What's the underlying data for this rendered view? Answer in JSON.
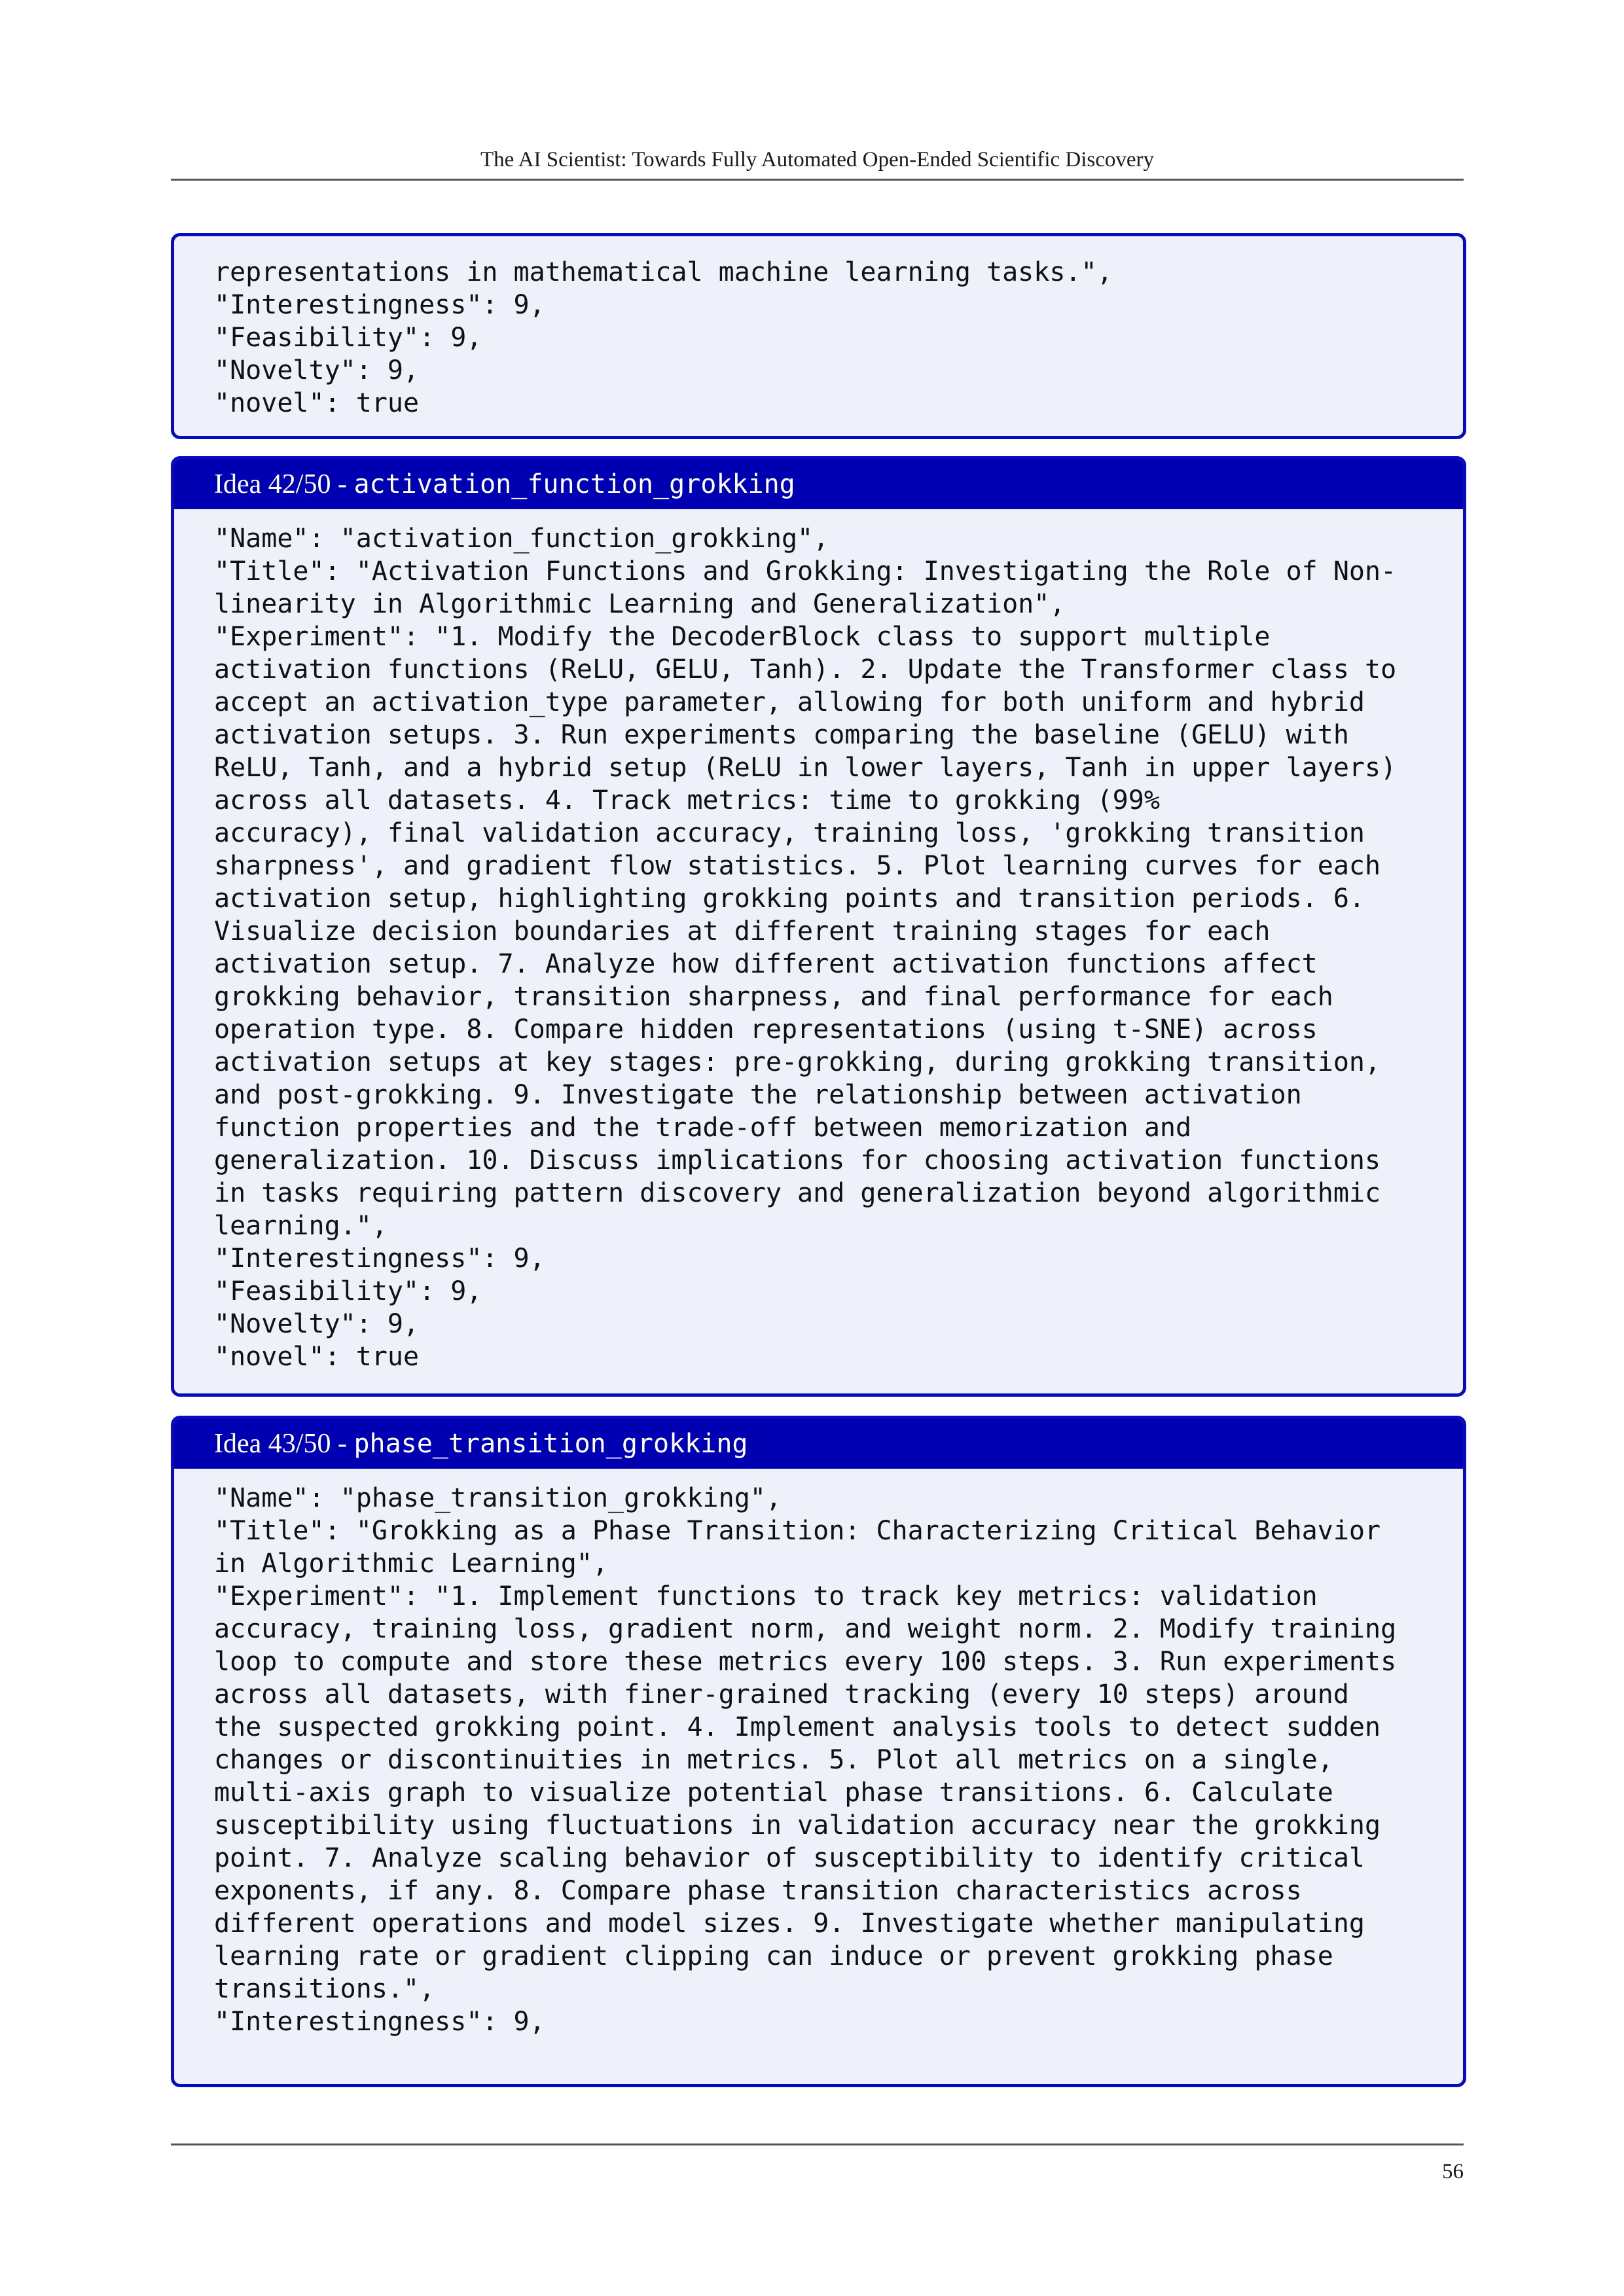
{
  "header": {
    "running_title": "The AI Scientist: Towards Fully Automated Open-Ended Scientific Discovery"
  },
  "box_top": {
    "lines": [
      "representations in mathematical machine learning tasks.\",",
      "\"Interestingness\": 9,",
      "\"Feasibility\": 9,",
      "\"Novelty\": 9,",
      "\"novel\": true"
    ]
  },
  "idea42": {
    "label": "Idea 42/50 - ",
    "name": "activation_function_grokking",
    "lines": [
      "\"Name\": \"activation_function_grokking\",",
      "\"Title\": \"Activation Functions and Grokking: Investigating the Role of Non-",
      "linearity in Algorithmic Learning and Generalization\",",
      "\"Experiment\": \"1. Modify the DecoderBlock class to support multiple",
      "activation functions (ReLU, GELU, Tanh). 2. Update the Transformer class to",
      "accept an activation_type parameter, allowing for both uniform and hybrid",
      "activation setups. 3. Run experiments comparing the baseline (GELU) with",
      "ReLU, Tanh, and a hybrid setup (ReLU in lower layers, Tanh in upper layers)",
      "across all datasets. 4. Track metrics: time to grokking (99%",
      "accuracy), final validation accuracy, training loss, 'grokking transition",
      "sharpness', and gradient flow statistics. 5. Plot learning curves for each",
      "activation setup, highlighting grokking points and transition periods. 6.",
      "Visualize decision boundaries at different training stages for each",
      "activation setup. 7. Analyze how different activation functions affect",
      "grokking behavior, transition sharpness, and final performance for each",
      "operation type. 8. Compare hidden representations (using t-SNE) across",
      "activation setups at key stages: pre-grokking, during grokking transition,",
      "and post-grokking. 9. Investigate the relationship between activation",
      "function properties and the trade-off between memorization and",
      "generalization. 10. Discuss implications for choosing activation functions",
      "in tasks requiring pattern discovery and generalization beyond algorithmic",
      "learning.\",",
      "\"Interestingness\": 9,",
      "\"Feasibility\": 9,",
      "\"Novelty\": 9,",
      "\"novel\": true"
    ]
  },
  "idea43": {
    "label": "Idea 43/50 - ",
    "name": "phase_transition_grokking",
    "lines": [
      "\"Name\": \"phase_transition_grokking\",",
      "\"Title\": \"Grokking as a Phase Transition: Characterizing Critical Behavior",
      "in Algorithmic Learning\",",
      "\"Experiment\": \"1. Implement functions to track key metrics: validation",
      "accuracy, training loss, gradient norm, and weight norm. 2. Modify training",
      "loop to compute and store these metrics every 100 steps. 3. Run experiments",
      "across all datasets, with finer-grained tracking (every 10 steps) around",
      "the suspected grokking point. 4. Implement analysis tools to detect sudden",
      "changes or discontinuities in metrics. 5. Plot all metrics on a single,",
      "multi-axis graph to visualize potential phase transitions. 6. Calculate",
      "susceptibility using fluctuations in validation accuracy near the grokking",
      "point. 7. Analyze scaling behavior of susceptibility to identify critical",
      "exponents, if any. 8. Compare phase transition characteristics across",
      "different operations and model sizes. 9. Investigate whether manipulating",
      "learning rate or gradient clipping can induce or prevent grokking phase",
      "transitions.\",",
      "\"Interestingness\": 9,"
    ]
  },
  "footer": {
    "page_number": "56"
  },
  "colors": {
    "box_border": "#0b0bbe",
    "title_bar": "#0000b3",
    "box_background": "#eef0fa"
  }
}
